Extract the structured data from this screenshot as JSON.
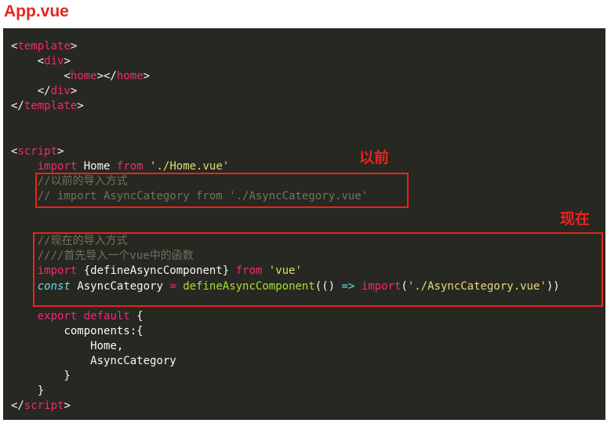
{
  "header": {
    "file_title": "App.vue"
  },
  "annotations": {
    "old_label": "以前",
    "new_label": "现在"
  },
  "code": {
    "template_open": "template",
    "div_tag": "div",
    "home_tag": "home",
    "template_close": "template",
    "script_tag": "script",
    "kw_import": "import",
    "kw_from": "from",
    "kw_const": "const",
    "kw_export": "export",
    "kw_default": "default",
    "ident_home": "Home",
    "str_home_path": "'./Home.vue'",
    "comment_old_title": "//以前的导入方式",
    "comment_old_import": "// import AsyncCategory from './AsyncCategory.vue'",
    "comment_new_title": "//现在的导入方式",
    "comment_new_step": "////首先导入一个vue中的函数",
    "ident_define_braced": "{defineAsyncComponent}",
    "str_vue": "'vue'",
    "ident_async_category": "AsyncCategory",
    "op_assign": "=",
    "fn_define": "defineAsyncComponent",
    "arrow_args": "(()",
    "op_arrow": "=>",
    "fn_dynamic_import": "import",
    "str_async_path": "'./AsyncCategory.vue'",
    "close_parens": "))",
    "ident_components": "components:{",
    "ident_home_item": "Home,",
    "ident_async_item": "AsyncCategory"
  },
  "colors": {
    "accent_red": "#e8241f",
    "editor_bg": "#272822",
    "tag_pink": "#f92672",
    "string_yellow": "#e6db74",
    "comment_gray": "#75715e",
    "function_green": "#a6e22e",
    "keyword_blue": "#66d9ef"
  }
}
